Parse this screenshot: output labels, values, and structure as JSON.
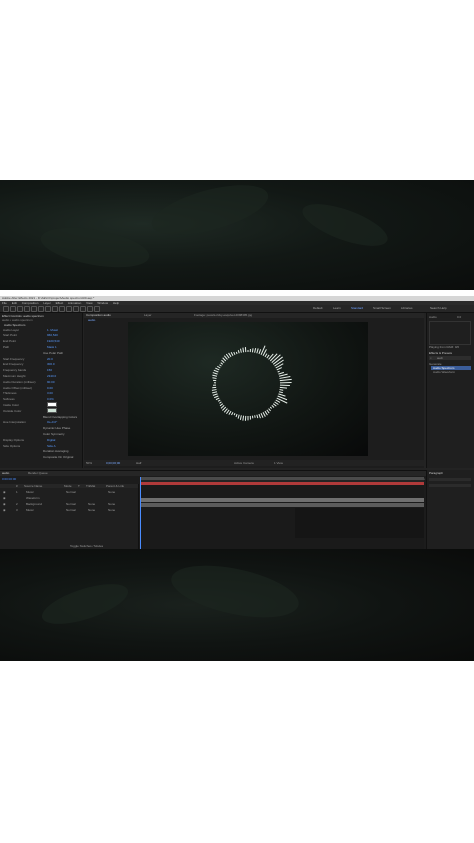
{
  "title_bar": {
    "text": "Adobe After Effects 2021 - D:\\AE\\CC\\project\\Audio spectrum\\00.aep *"
  },
  "menu": [
    "File",
    "Edit",
    "Composition",
    "Layer",
    "Effect",
    "Animation",
    "View",
    "Window",
    "Help"
  ],
  "workspaces": [
    "Default",
    "Learn",
    "Standard",
    "Small Screen",
    "Libraries"
  ],
  "active_workspace": "Standard",
  "search_help": "Search Help",
  "effect_controls": {
    "tab": "Effect Controls: audio spectrum",
    "layer_path": "audio • audio spectrum",
    "effect_name": "Audio Spectrum",
    "rows": [
      {
        "label": "Audio Layer",
        "value": "1. Music"
      },
      {
        "label": "Start Point",
        "value": "960,540"
      },
      {
        "label": "End Point",
        "value": "1920,540"
      },
      {
        "label": "Path",
        "value": "Mask 1"
      },
      {
        "label": "",
        "value": "Use Polar Path"
      },
      {
        "label": "Start Frequency",
        "value": "20.0"
      },
      {
        "label": "End Frequency",
        "value": "300.0"
      },
      {
        "label": "Frequency bands",
        "value": "150"
      },
      {
        "label": "Maximum Height",
        "value": "2340.0"
      },
      {
        "label": "Audio Duration (millisec)",
        "value": "90.00"
      },
      {
        "label": "Audio Offset (millisec)",
        "value": "0.00"
      },
      {
        "label": "Thickness",
        "value": "3.00"
      },
      {
        "label": "Softness",
        "value": "0.0%"
      },
      {
        "label": "Inside Color",
        "value": ""
      },
      {
        "label": "Outside Color",
        "value": ""
      },
      {
        "label": "",
        "value": "Blend Overlapping Colors"
      },
      {
        "label": "Hue Interpolation",
        "value": "0x+0.0°"
      },
      {
        "label": "",
        "value": "Dynamic Hue Phase"
      },
      {
        "label": "",
        "value": "Color Symmetry"
      },
      {
        "label": "Display Options",
        "value": "Digital"
      },
      {
        "label": "Side Options",
        "value": "Side A"
      },
      {
        "label": "",
        "value": "Duration Averaging"
      },
      {
        "label": "",
        "value": "Composite On Original"
      }
    ]
  },
  "composition": {
    "tabs": [
      "Composition audio",
      "Layer"
    ],
    "active_tab": "audio",
    "viewer_path": "Footage: pexels-ricky-esquivel-2098395.jpg",
    "zoom": "50%",
    "timecode": "0;00;00;00",
    "resolution": "Half",
    "camera": "Active Camera",
    "views": "1 View"
  },
  "right_panel": {
    "audio_label": "Audio",
    "audio_value": "0.0",
    "effects_presets_tab": "Effects & Presets",
    "search_value": "audi",
    "category": "Generate",
    "results": [
      "Audio Spectrum",
      "Audio Waveform"
    ],
    "info": "Playing from RAM: 0/0"
  },
  "timeline": {
    "tabs": [
      "audio",
      "Render Queue"
    ],
    "timecode": "0:00:00:00",
    "columns": [
      "#",
      "Source Name",
      "Mode",
      "T",
      "TrkMat",
      "Parent & Link"
    ],
    "layers": [
      {
        "num": "1",
        "name": "Music",
        "mode": "Normal",
        "trkmat": "",
        "parent": "None"
      },
      {
        "num": "",
        "name": "Waveform",
        "mode": "",
        "trkmat": "",
        "parent": ""
      },
      {
        "num": "2",
        "name": "Background",
        "mode": "Normal",
        "trkmat": "None",
        "parent": "None"
      },
      {
        "num": "3",
        "name": "Music",
        "mode": "Normal",
        "trkmat": "None",
        "parent": "None"
      }
    ],
    "ruler": [
      "0s",
      "02s",
      "04s",
      "06s",
      "08s",
      "10s",
      "12s",
      "14s",
      "16s",
      "18s",
      "20s",
      "22s",
      "24s"
    ],
    "footer": "Toggle Switches / Modes"
  },
  "paragraph_panel": {
    "tab": "Paragraph"
  },
  "colors": {
    "accent": "#4a8cff",
    "work_area": "#b03a3a",
    "audio_bar": "#6f6f6f",
    "panel": "#232323"
  }
}
